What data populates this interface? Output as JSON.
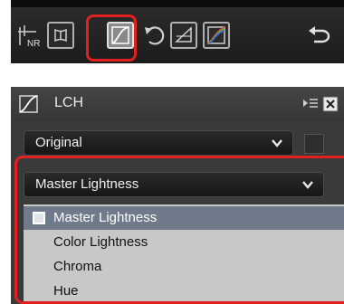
{
  "toolbar": {
    "buttons": [
      "noise-reduction-icon",
      "distortion-icon",
      "lch-curve-icon",
      "rotate-icon",
      "perspective-icon",
      "color-curve-icon"
    ],
    "undo_icon": "undo-icon",
    "nr_label": "NR"
  },
  "panel": {
    "title": "LCH",
    "mode_select": {
      "value": "Original"
    },
    "channel_select": {
      "value": "Master Lightness"
    },
    "dropdown": {
      "items": [
        "Master Lightness",
        "Color Lightness",
        "Chroma",
        "Hue"
      ],
      "selected_index": 0
    }
  },
  "colors": {
    "highlight": "#e32020",
    "selected_item": "#6f7a8a"
  }
}
